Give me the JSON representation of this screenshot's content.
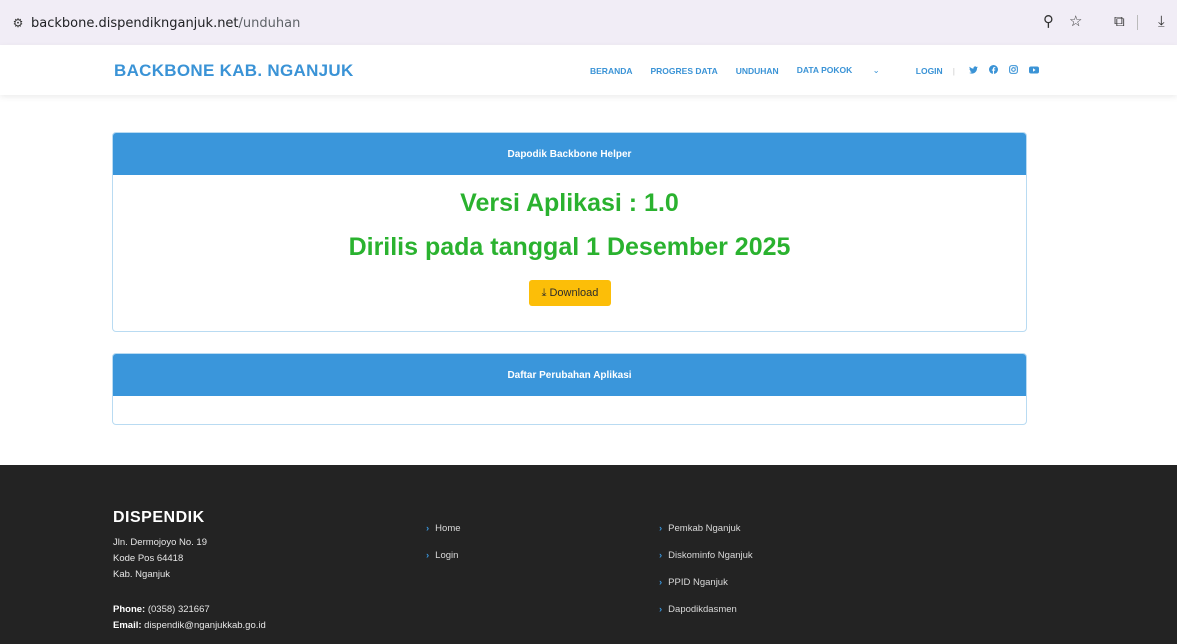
{
  "browser": {
    "url_host": "backbone.dispendiknganjuk.net",
    "url_path": "/unduhan"
  },
  "header": {
    "brand": "BACKBONE KAB. NGANJUK",
    "nav": [
      "BERANDA",
      "PROGRES DATA",
      "UNDUHAN",
      "DATA POKOK",
      "LOGIN"
    ]
  },
  "card1": {
    "title": "Dapodik Backbone Helper",
    "version": "Versi Aplikasi : 1.0",
    "release": "Dirilis pada tanggal 1 Desember 2025",
    "download_label": "Download"
  },
  "card2": {
    "title": "Daftar Perubahan Aplikasi"
  },
  "footer": {
    "title": "DISPENDIK",
    "address": [
      "Jln. Dermojoyo No. 19",
      "Kode Pos 64418",
      "Kab. Nganjuk"
    ],
    "phone_label": "Phone:",
    "phone": "(0358) 321667",
    "email_label": "Email:",
    "email": "dispendik@nganjukkab.go.id",
    "links_col1": [
      "Home",
      "Login"
    ],
    "links_col2": [
      "Pemkab Nganjuk",
      "Diskominfo Nganjuk",
      "PPID Nganjuk",
      "Dapodikdasmen"
    ]
  },
  "colors": {
    "accent": "#3a93d6",
    "card_header": "#3a96db",
    "version_text": "#2ab22f",
    "download_button": "#fcbe08",
    "footer_bg": "#232323"
  }
}
